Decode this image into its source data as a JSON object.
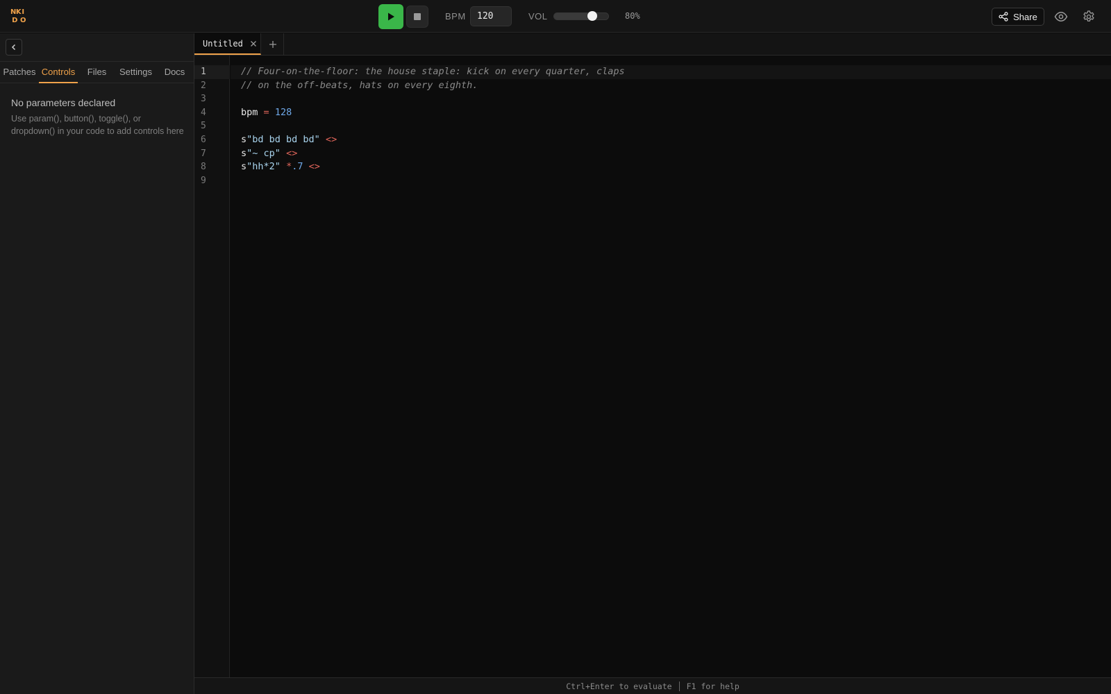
{
  "app": {
    "logo_letters": [
      "NK",
      "I",
      "D",
      "O"
    ],
    "accent_color": "#f0a24a",
    "play_color": "#3ab649"
  },
  "transport": {
    "play_icon": "play-icon",
    "stop_icon": "stop-icon",
    "bpm_label": "BPM",
    "bpm_value": "120",
    "vol_label": "VOL",
    "vol_level": 0.7,
    "vol_display": "80%"
  },
  "header_actions": {
    "share_label": "Share",
    "share_icon": "share-icon",
    "preview_icon": "eye-icon",
    "settings_icon": "gear-icon"
  },
  "sidebar": {
    "collapse_icon": "chevron-left-icon",
    "tabs": [
      {
        "label": "Patches",
        "active": false
      },
      {
        "label": "Controls",
        "active": true
      },
      {
        "label": "Files",
        "active": false
      },
      {
        "label": "Settings",
        "active": false
      },
      {
        "label": "Docs",
        "active": false
      }
    ],
    "panel_title": "No parameters declared",
    "panel_desc": "Use param(), button(), toggle(), or dropdown() in your code to add controls here"
  },
  "editor": {
    "tabs": [
      {
        "label": "Untitled",
        "close_icon": "close-icon"
      }
    ],
    "add_tab_icon": "plus-icon",
    "line_numbers": [
      "1",
      "2",
      "3",
      "4",
      "5",
      "6",
      "7",
      "8",
      "9"
    ],
    "active_line": 1,
    "code": {
      "line1": "// Four-on-the-floor: the house staple: kick on every quarter, claps",
      "line2": "// on the off-beats, hats on every eighth.",
      "line4_ident": "bpm",
      "line4_op": "=",
      "line4_num": "128",
      "line6_prefix": "s",
      "line6_str": "\"bd bd bd bd\"",
      "line6_marker": "<>",
      "line7_prefix": "s",
      "line7_str": "\"~ cp\"",
      "line7_marker": "<>",
      "line8_prefix": "s",
      "line8_str": "\"hh*2\"",
      "line8_op": "*",
      "line8_num": ".7",
      "line8_marker": "<>"
    }
  },
  "status": {
    "hint_evaluate": "Ctrl+Enter to evaluate",
    "hint_help": "F1 for help"
  }
}
